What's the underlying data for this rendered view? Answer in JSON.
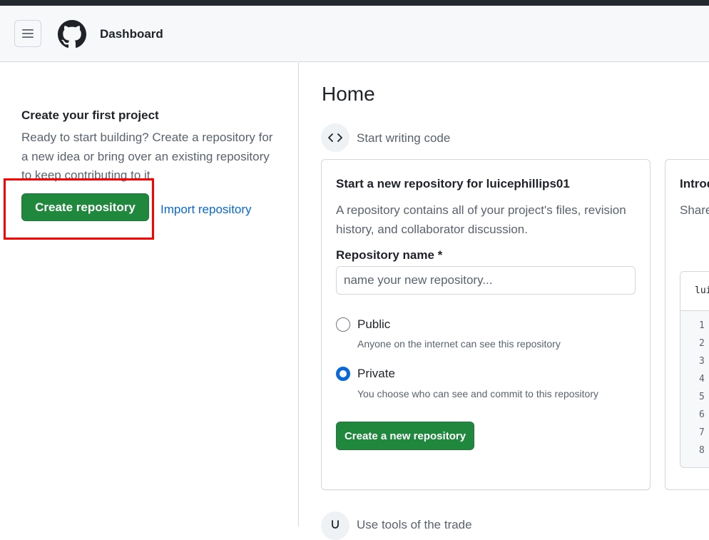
{
  "header": {
    "title": "Dashboard",
    "menu_icon": "hamburger-icon",
    "logo_icon": "github-logo-icon"
  },
  "sidebar": {
    "heading": "Create your first project",
    "description": "Ready to start building? Create a repository for a new idea or bring over an existing repository to keep contributing to it.",
    "create_button": "Create repository",
    "import_link": "Import repository"
  },
  "main": {
    "title": "Home",
    "start_section": {
      "icon": "code-icon",
      "label": "Start writing code"
    },
    "new_repo_card": {
      "title": "Start a new repository for luicephillips01",
      "description": "A repository contains all of your project's files, revision history, and collaborator discussion.",
      "name_label": "Repository name *",
      "name_placeholder": "name your new repository...",
      "visibility_options": [
        {
          "label": "Public",
          "description": "Anyone on the internet can see this repository",
          "checked": false
        },
        {
          "label": "Private",
          "description": "You choose who can see and commit to this repository",
          "checked": true
        }
      ],
      "submit_button": "Create a new repository"
    },
    "intro_card": {
      "title": "Introd",
      "description": "Share READ page.",
      "code_path": "lui",
      "line_numbers": [
        "1",
        "2",
        "3",
        "4",
        "5",
        "6",
        "7",
        "8"
      ]
    },
    "tools_section": {
      "icon": "tools-icon",
      "label": "Use tools of the trade"
    }
  },
  "colors": {
    "primary_button": "#1f883d",
    "link": "#0969da",
    "highlight_box": "#ff0000",
    "header_bg": "#f6f8fa",
    "top_strip": "#24292f"
  }
}
